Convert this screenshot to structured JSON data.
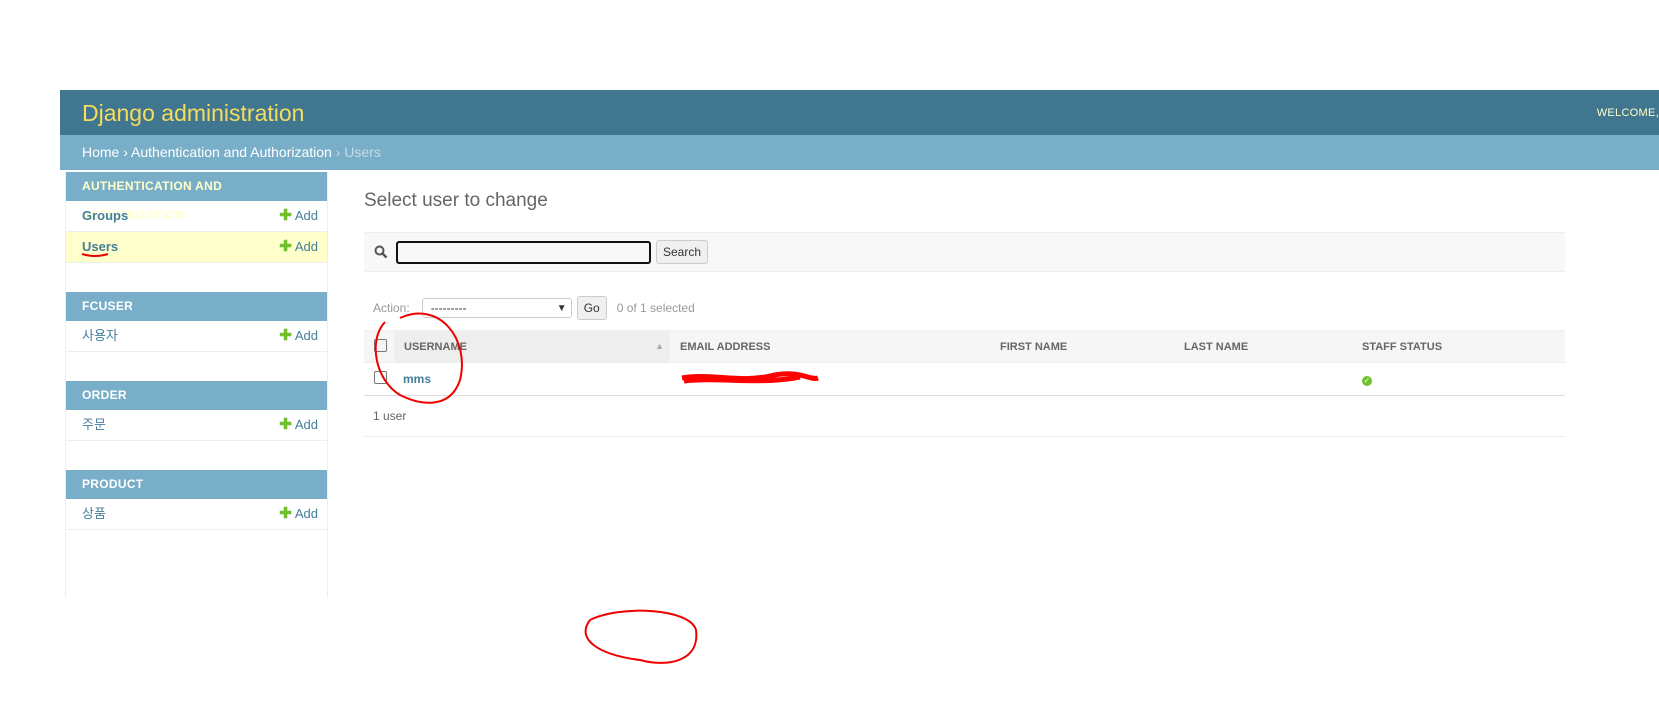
{
  "header": {
    "brand": "Django administration",
    "welcome": "WELCOME, "
  },
  "breadcrumbs": {
    "home": "Home",
    "sep": " › ",
    "app": "Authentication and Authorization",
    "current": "Users"
  },
  "sidebar": {
    "modules": [
      {
        "title": "AUTHENTICATION AND AUTHORIZATION",
        "items": [
          {
            "label": "Groups",
            "add": "Add"
          },
          {
            "label": "Users",
            "add": "Add",
            "selected": true
          }
        ]
      },
      {
        "title": "FCUSER",
        "items": [
          {
            "label": "사용자",
            "add": "Add"
          }
        ]
      },
      {
        "title": "ORDER",
        "items": [
          {
            "label": "주문",
            "add": "Add"
          }
        ]
      },
      {
        "title": "PRODUCT",
        "items": [
          {
            "label": "상품",
            "add": "Add"
          }
        ]
      }
    ]
  },
  "main": {
    "title": "Select user to change",
    "search": {
      "value": "",
      "button": "Search",
      "icon": "search-icon"
    },
    "actions": {
      "label": "Action:",
      "selected": "---------",
      "go": "Go",
      "counter": "0 of 1 selected"
    },
    "table": {
      "columns": [
        "USERNAME",
        "EMAIL ADDRESS",
        "FIRST NAME",
        "LAST NAME",
        "STAFF STATUS"
      ],
      "rows": [
        {
          "username": "mms",
          "email": "",
          "first_name": "",
          "last_name": "",
          "staff_status": true
        }
      ]
    },
    "result_count": "1 user"
  },
  "colors": {
    "header": "#417690",
    "brand": "#f5dd5d",
    "breadcrumbs": "#79aec8",
    "link": "#447e9b",
    "add": "#70bf2b",
    "annotation": "#ff0000"
  }
}
